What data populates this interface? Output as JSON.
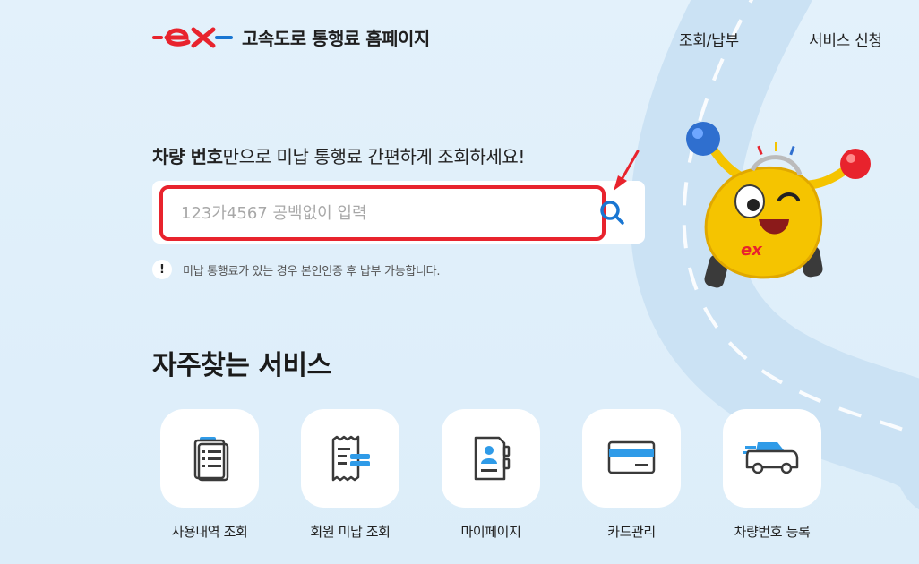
{
  "header": {
    "logo_text": "ex",
    "title": "고속도로 통행료 홈페이지",
    "nav": [
      {
        "label": "조회/납부"
      },
      {
        "label": "서비스 신청"
      }
    ]
  },
  "search": {
    "headline_bold": "차량 번호",
    "headline_rest": "만으로 미납 통행료 간편하게 조회하세요!",
    "placeholder": "123가4567 공백없이 입력",
    "value": ""
  },
  "notice": {
    "icon": "!",
    "text": "미납 통행료가 있는 경우 본인인증 후 납부 가능합니다."
  },
  "services": {
    "title": "자주찾는 서비스",
    "items": [
      {
        "label": "사용내역 조회",
        "icon": "document-list-icon"
      },
      {
        "label": "회원 미납 조회",
        "icon": "receipt-icon"
      },
      {
        "label": "마이페이지",
        "icon": "profile-card-icon"
      },
      {
        "label": "카드관리",
        "icon": "credit-card-icon"
      },
      {
        "label": "차량번호 등록",
        "icon": "car-icon"
      }
    ]
  },
  "colors": {
    "brand_red": "#e8232d",
    "brand_blue": "#1976d2",
    "accent_blue": "#2f9be8",
    "background": "#e3f1fb"
  }
}
